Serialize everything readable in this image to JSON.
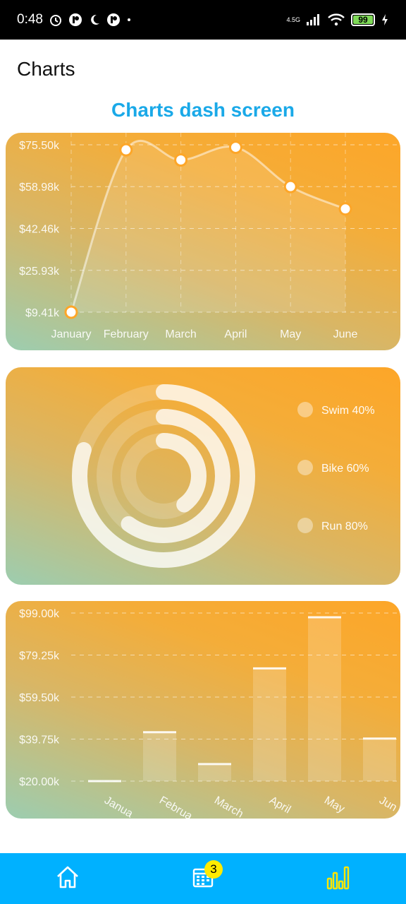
{
  "status_bar": {
    "time": "0:48",
    "network": "4.5G",
    "battery": "99"
  },
  "app_bar": {
    "title": "Charts"
  },
  "screen_title": "Charts dash screen",
  "line_chart": {
    "chart_data": {
      "type": "line",
      "categories": [
        "January",
        "February",
        "March",
        "April",
        "May",
        "June"
      ],
      "values": [
        9.41,
        73.5,
        69.5,
        74.5,
        59.0,
        50.2
      ],
      "ytick_labels": [
        "$75.50k",
        "$58.98k",
        "$42.46k",
        "$25.93k",
        "$9.41k"
      ],
      "ytick_values": [
        75.5,
        58.98,
        42.46,
        25.93,
        9.41
      ],
      "ylim": [
        9.41,
        75.5
      ],
      "grid": true
    }
  },
  "radial_chart": {
    "chart_data": {
      "type": "radial-bar",
      "legend": [
        {
          "label": "Swim 40%",
          "value": 40
        },
        {
          "label": "Bike 60%",
          "value": 60
        },
        {
          "label": "Run 80%",
          "value": 80
        }
      ]
    }
  },
  "bar_chart": {
    "chart_data": {
      "type": "bar",
      "categories": [
        "January",
        "February",
        "March",
        "April",
        "May",
        "June"
      ],
      "tick_labels": [
        "Janua",
        "Februa",
        "March",
        "April",
        "May",
        "Jun"
      ],
      "values": [
        20.0,
        43.0,
        28.0,
        73.0,
        97.0,
        40.0
      ],
      "ytick_labels": [
        "$99.00k",
        "$79.25k",
        "$59.50k",
        "$39.75k",
        "$20.00k"
      ],
      "ytick_values": [
        99.0,
        79.25,
        59.5,
        39.75,
        20.0
      ],
      "ylim": [
        20.0,
        99.0
      ],
      "grid": true
    }
  },
  "bottom_nav": {
    "items": [
      {
        "icon": "home-icon"
      },
      {
        "icon": "calendar-icon",
        "badge": "3"
      },
      {
        "icon": "bar-chart-icon"
      }
    ]
  }
}
